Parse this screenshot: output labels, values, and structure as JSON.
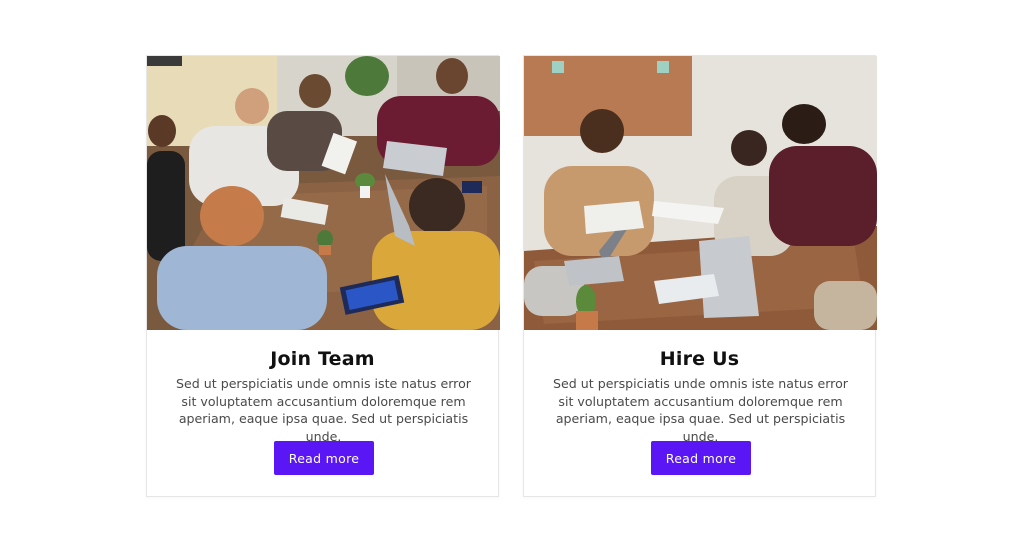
{
  "theme": {
    "accent": "#5b16f5"
  },
  "cards": [
    {
      "title": "Join Team",
      "description": "Sed ut perspiciatis unde omnis iste natus error sit voluptatem accusantium doloremque rem aperiam, eaque ipsa quae. Sed ut perspiciatis unde.",
      "button_label": "Read more",
      "image": "team-meeting-photo"
    },
    {
      "title": "Hire Us",
      "description": "Sed ut perspiciatis unde omnis iste natus error sit voluptatem accusantium doloremque rem aperiam, eaque ipsa quae. Sed ut perspiciatis unde.",
      "button_label": "Read more",
      "image": "office-collaboration-photo"
    }
  ]
}
